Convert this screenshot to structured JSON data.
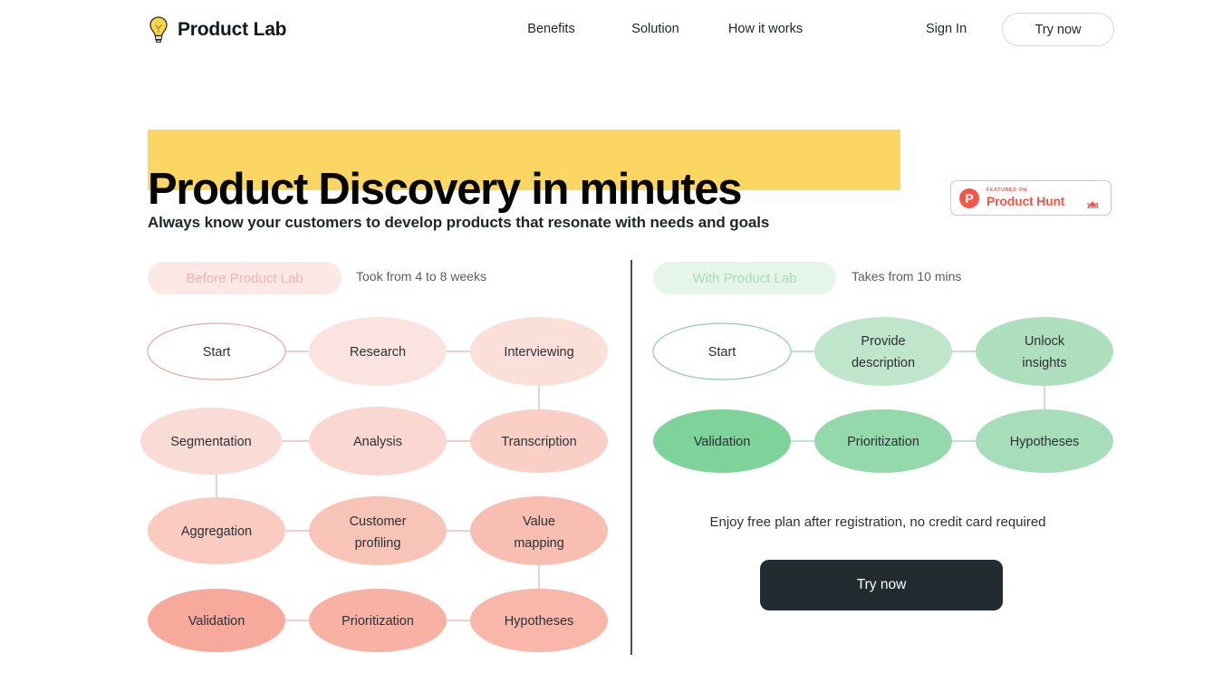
{
  "header": {
    "brand": "Product Lab",
    "logo_icon": "lightbulb-icon",
    "nav": [
      {
        "label": "Benefits"
      },
      {
        "label": "Solution"
      },
      {
        "label": "How it works"
      }
    ],
    "sign_in": "Sign In",
    "try_now": "Try now"
  },
  "hero": {
    "headline": "Product Discovery in minutes",
    "subheadline": "Always know your customers to develop products that resonate with needs and goals",
    "highlight_color": "#fcd663"
  },
  "product_hunt": {
    "mark": "P",
    "featured_on": "FEATURED ON",
    "name": "Product Hunt",
    "upvotes": "133",
    "accent_color": "#f2584a"
  },
  "comparison": {
    "before": {
      "pill_label": "Before Product Lab",
      "timing": "Took from 4 to 8 weeks",
      "pill_bg": "#fce9e6",
      "pill_text_color": "#f6b3a9",
      "nodes": [
        {
          "label": "Start",
          "row": 0,
          "col": 0,
          "fill": "none",
          "outline": "#e8a89e"
        },
        {
          "label": "Research",
          "row": 0,
          "col": 1,
          "fill": "#fbe4e0"
        },
        {
          "label": "Interviewing",
          "row": 0,
          "col": 2,
          "fill": "#fbe0da"
        },
        {
          "label": "Segmentation",
          "row": 1,
          "col": 0,
          "fill": "#fadcd6"
        },
        {
          "label": "Analysis",
          "row": 1,
          "col": 1,
          "fill": "#fad8d1"
        },
        {
          "label": "Transcription",
          "row": 1,
          "col": 2,
          "fill": "#f9cfc6"
        },
        {
          "label": "Aggregation",
          "row": 2,
          "col": 0,
          "fill": "#f9cbc1"
        },
        {
          "label": "Customer profiling",
          "row": 2,
          "col": 1,
          "fill": "#f8c4b8"
        },
        {
          "label": "Value mapping",
          "row": 2,
          "col": 2,
          "fill": "#f8beb1"
        },
        {
          "label": "Validation",
          "row": 3,
          "col": 0,
          "fill": "#f7aa9b"
        },
        {
          "label": "Prioritization",
          "row": 3,
          "col": 1,
          "fill": "#f8b2a4"
        },
        {
          "label": "Hypotheses",
          "row": 3,
          "col": 2,
          "fill": "#f8b7a9"
        }
      ],
      "connector_color": "#eab2a8"
    },
    "with": {
      "pill_label": "With Product Lab",
      "timing": "Takes from 10 mins",
      "pill_bg": "#e6f5ea",
      "pill_text_color": "#a6dcb6",
      "nodes": [
        {
          "label": "Start",
          "row": 0,
          "col": 0,
          "fill": "none",
          "outline": "#8fcfa4"
        },
        {
          "label": "Provide description",
          "row": 0,
          "col": 1,
          "fill": "#bfe6cb"
        },
        {
          "label": "Unlock insights",
          "row": 0,
          "col": 2,
          "fill": "#aee0bf"
        },
        {
          "label": "Validation",
          "row": 1,
          "col": 0,
          "fill": "#7ed39a"
        },
        {
          "label": "Prioritization",
          "row": 1,
          "col": 1,
          "fill": "#93d9ab"
        },
        {
          "label": "Hypotheses",
          "row": 1,
          "col": 2,
          "fill": "#a7deb9"
        }
      ],
      "connector_color": "#9ed3ae"
    }
  },
  "cta_section": {
    "note": "Enjoy free plan after registration, no credit card required",
    "button_label": "Try now",
    "button_color": "#222b2f"
  }
}
